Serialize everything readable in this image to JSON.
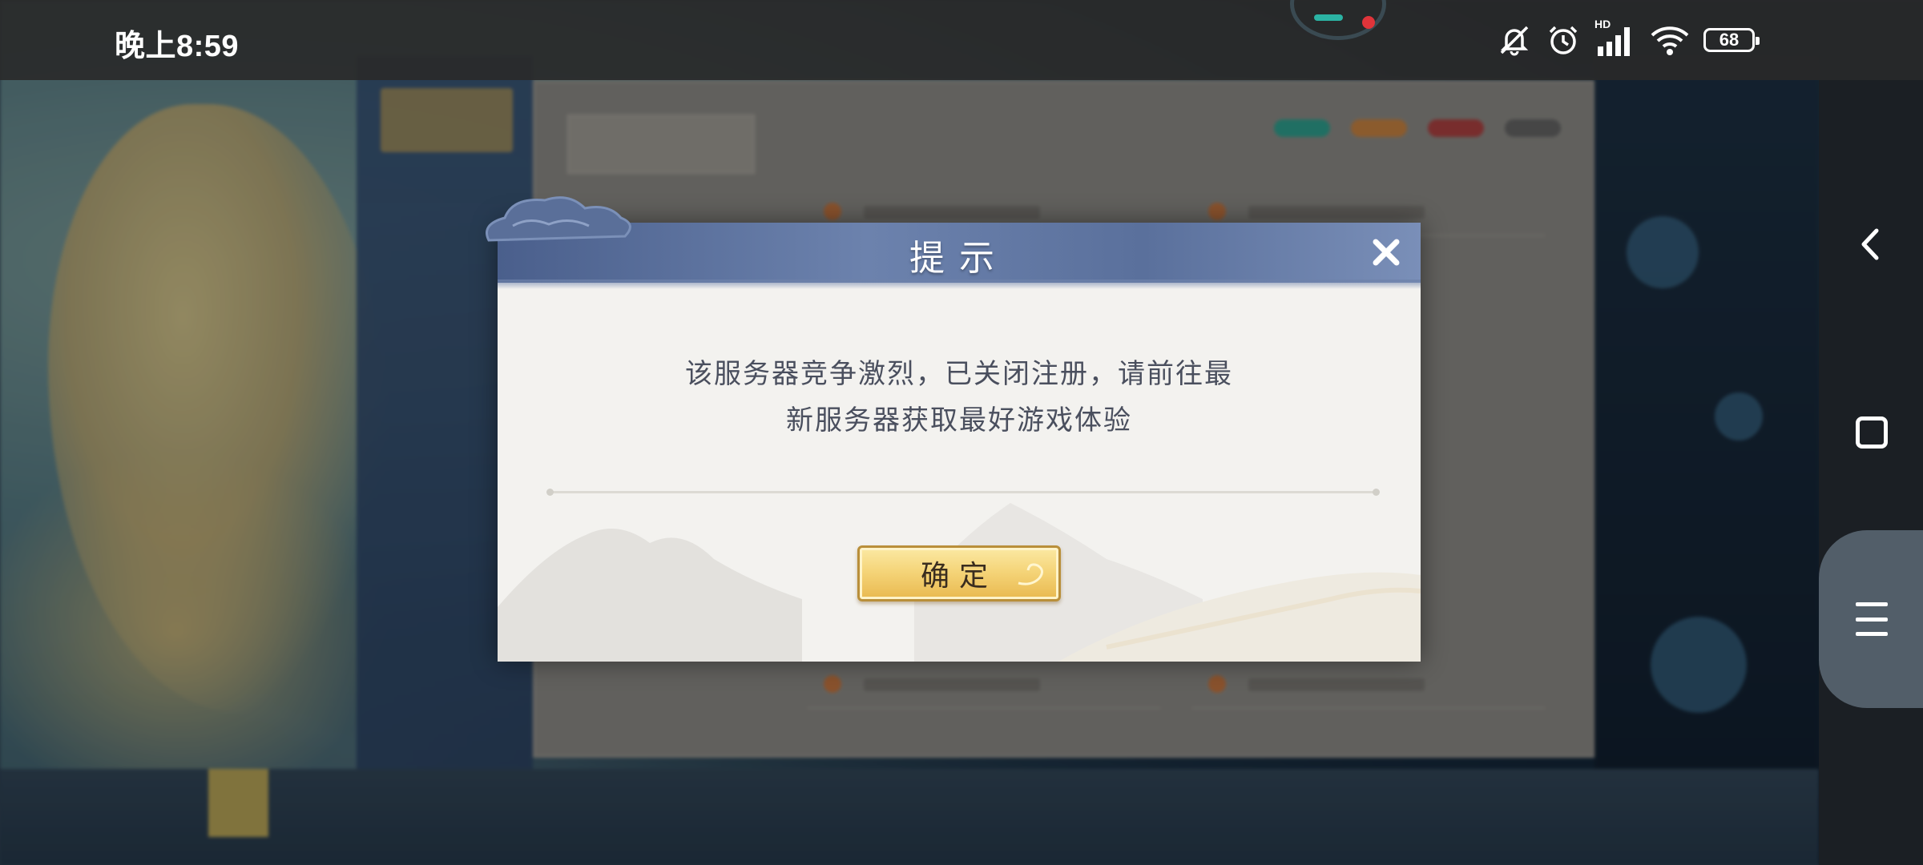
{
  "status_bar": {
    "time": "晚上8:59",
    "network_badge": "HD",
    "battery_level": "68",
    "icons": [
      "mute-icon",
      "alarm-icon",
      "signal-icon",
      "wifi-icon",
      "battery-icon"
    ]
  },
  "dialog": {
    "title": "提示",
    "message_line1": "该服务器竞争激烈，已关闭注册，请前往最",
    "message_line2": "新服务器获取最好游戏体验",
    "confirm_label": "确定",
    "close_icon": "close-icon"
  },
  "nav_bar": {
    "icons": [
      "back-icon",
      "home-icon",
      "menu-icon"
    ]
  },
  "colors": {
    "header_blue": "#5a709c",
    "confirm_gold": "#f5d57a",
    "message_text": "#4a4f5e"
  }
}
